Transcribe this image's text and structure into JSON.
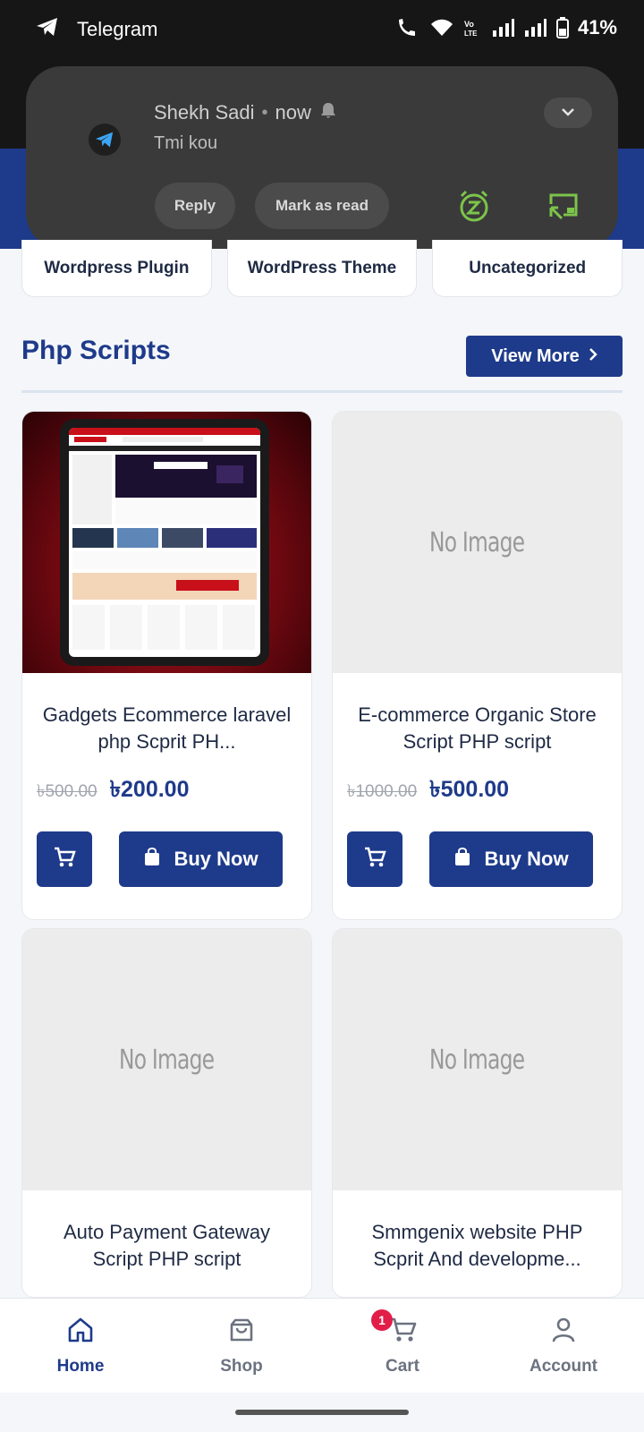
{
  "status_bar": {
    "app": "Telegram",
    "battery": "41%"
  },
  "notification": {
    "sender": "Shekh Sadi",
    "time": "now",
    "message": "Tmi kou",
    "reply_label": "Reply",
    "mark_read_label": "Mark as read"
  },
  "categories": [
    "Wordpress Plugin",
    "WordPress Theme",
    "Uncategorized"
  ],
  "section": {
    "title": "Php Scripts",
    "view_more": "View More"
  },
  "products": [
    {
      "title": "Gadgets Ecommerce laravel php Scprit PH...",
      "old_price": "৳500.00",
      "price": "৳200.00",
      "buy_label": "Buy Now",
      "image": "photo"
    },
    {
      "title": "E-commerce Organic Store Script PHP script",
      "old_price": "৳1000.00",
      "price": "৳500.00",
      "buy_label": "Buy Now",
      "image": "No Image"
    },
    {
      "title": "Auto Payment Gateway Script PHP script",
      "image": "No Image"
    },
    {
      "title": "Smmgenix website PHP Scprit And developme...",
      "image": "No Image"
    }
  ],
  "bottom_nav": [
    {
      "label": "Home",
      "icon": "home-icon",
      "active": true
    },
    {
      "label": "Shop",
      "icon": "shop-icon"
    },
    {
      "label": "Cart",
      "icon": "cart-icon",
      "badge": "1"
    },
    {
      "label": "Account",
      "icon": "account-icon"
    }
  ],
  "colors": {
    "brand": "#1e3a8a",
    "notification_bg": "#3a3a3a",
    "badge": "#e11d48"
  }
}
